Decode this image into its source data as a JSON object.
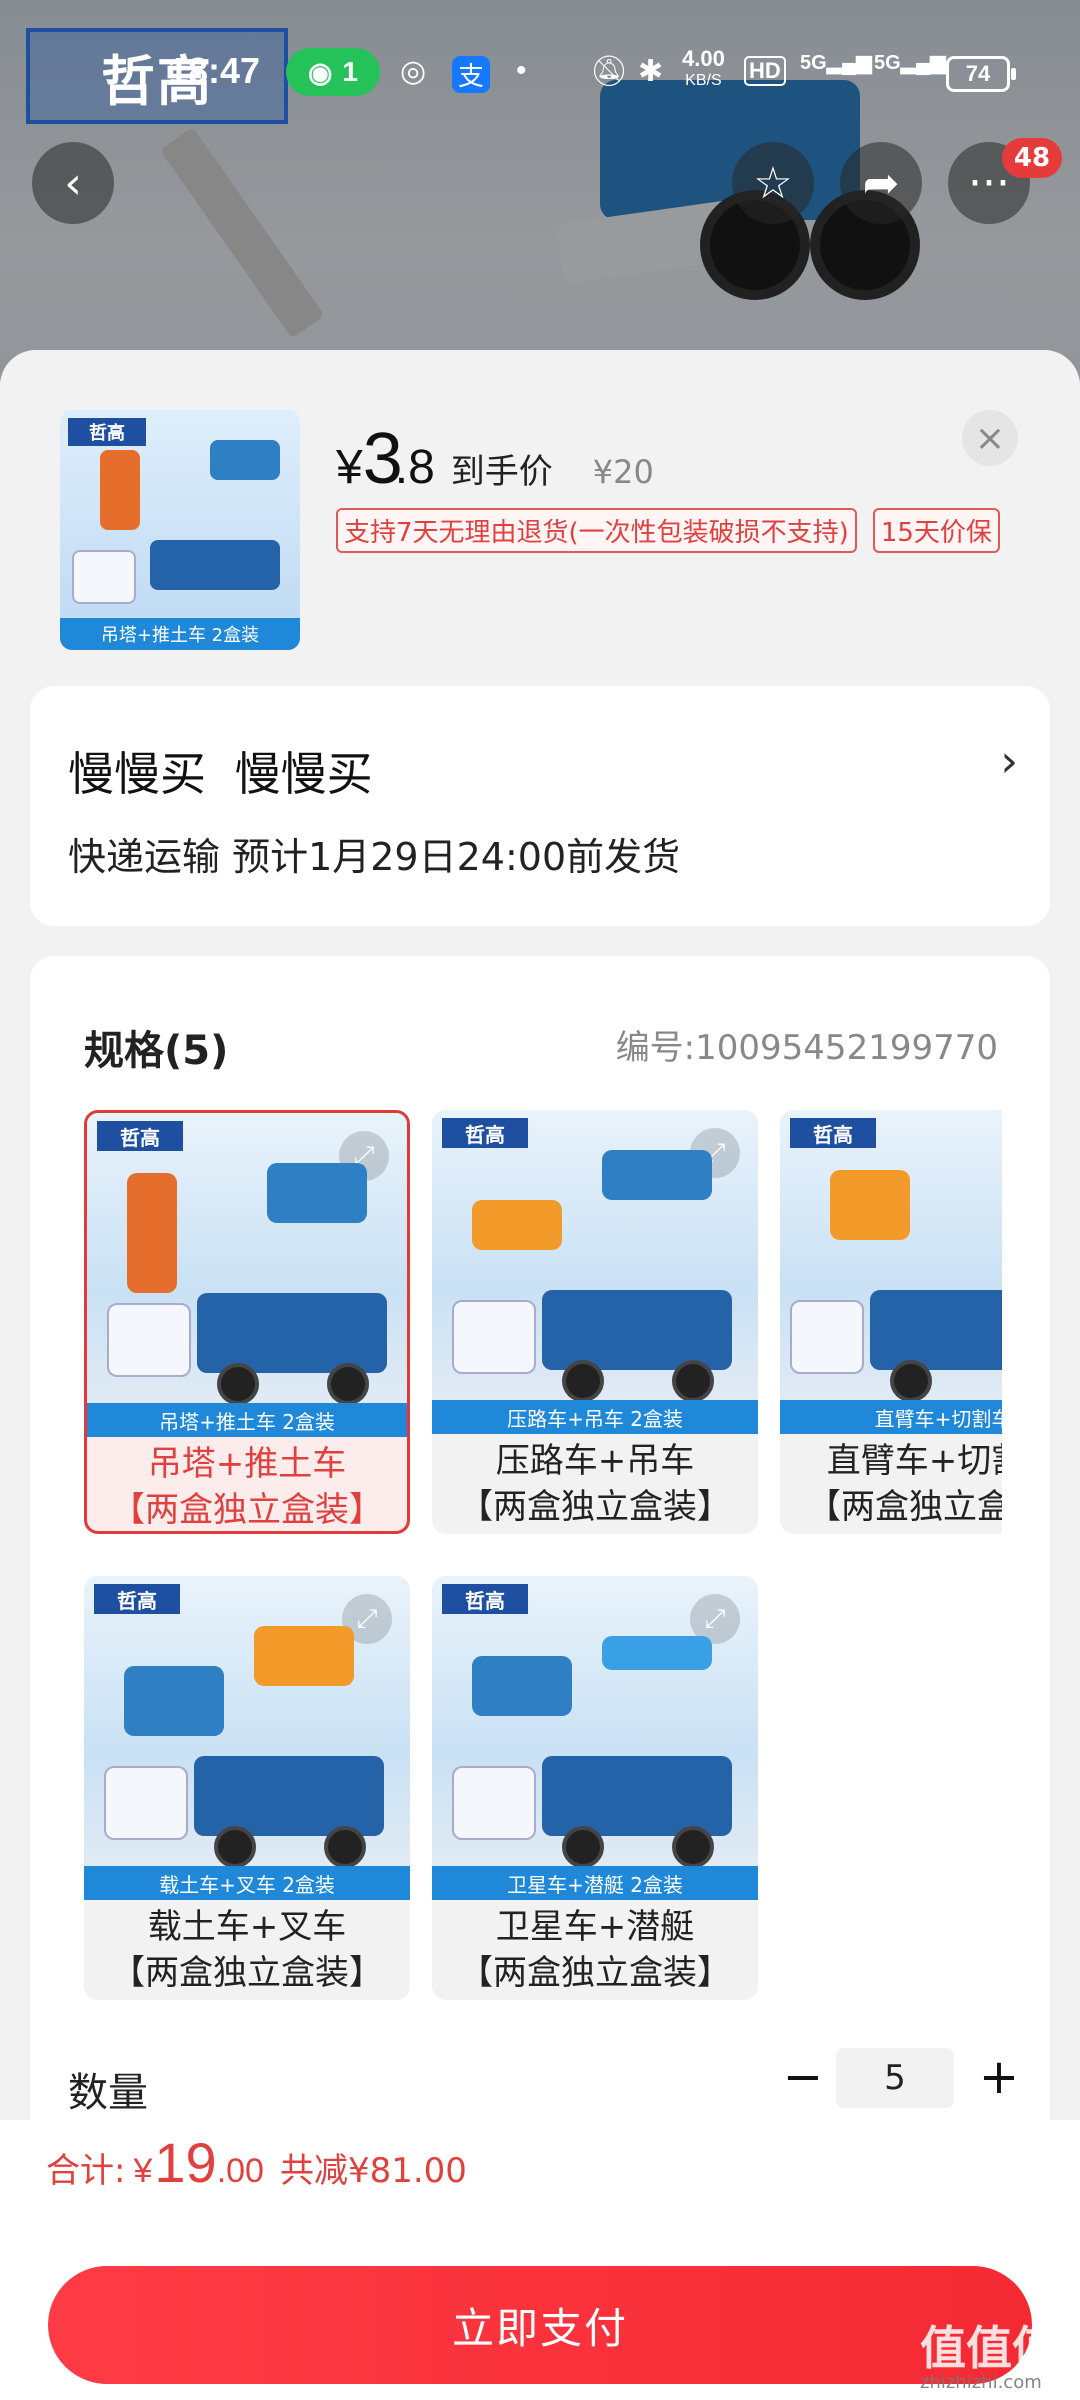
{
  "status_bar": {
    "time": "18:47",
    "wifi_count": "1",
    "net_speed_value": "4.00",
    "net_speed_unit": "KB/S",
    "hd_label": "HD",
    "signal_1": "5G",
    "signal_2": "5G",
    "battery": "74"
  },
  "hero": {
    "brand_logo_text": "哲高"
  },
  "top_actions": {
    "back_icon": "chevron-left-icon",
    "favorite_icon": "star-icon",
    "share_icon": "share-icon",
    "more_icon": "more-icon",
    "more_badge": "48"
  },
  "product": {
    "thumb_caption": "吊塔+推土车 2盒装",
    "price_symbol": "¥",
    "price_int": "3",
    "price_dec": ".8",
    "price_label": "到手价",
    "original_price": "¥20",
    "tags": [
      "支持7天无理由退货(一次性包装破损不支持)",
      "15天价保"
    ]
  },
  "shipping": {
    "title": "慢慢买 慢慢买",
    "subtitle": "快递运输 预计1月29日24:00前发货"
  },
  "spec": {
    "title": "规格(5)",
    "code": "编号:10095452199770",
    "options": [
      {
        "caption": "吊塔+推土车 2盒装",
        "line1": "吊塔+推土车",
        "line2": "【两盒独立盒装】",
        "selected": true
      },
      {
        "caption": "压路车+吊车 2盒装",
        "line1": "压路车+吊车",
        "line2": "【两盒独立盒装】",
        "selected": false
      },
      {
        "caption": "直臂车+切割车",
        "line1": "直臂车+切割车",
        "line2": "【两盒独立盒装】",
        "selected": false
      },
      {
        "caption": "载土车+叉车 2盒装",
        "line1": "载土车+叉车",
        "line2": "【两盒独立盒装】",
        "selected": false
      },
      {
        "caption": "卫星车+潜艇 2盒装",
        "line1": "卫星车+潜艇",
        "line2": "【两盒独立盒装】",
        "selected": false
      }
    ]
  },
  "quantity": {
    "label": "数量",
    "value": "5",
    "minus": "−",
    "plus": "+"
  },
  "footer": {
    "total_label": "合计:",
    "total_symbol": "¥",
    "total_int": "19",
    "total_dec": ".00",
    "saved": "共减¥81.00",
    "pay_button": "立即支付"
  },
  "watermark": {
    "text": "值值值",
    "sub": "zhizhizhi.com"
  },
  "colors": {
    "accent_red": "#e0413f",
    "pay_button": "#f42a33",
    "caption_blue": "#1f88d8",
    "wifi_green": "#25c25a"
  }
}
